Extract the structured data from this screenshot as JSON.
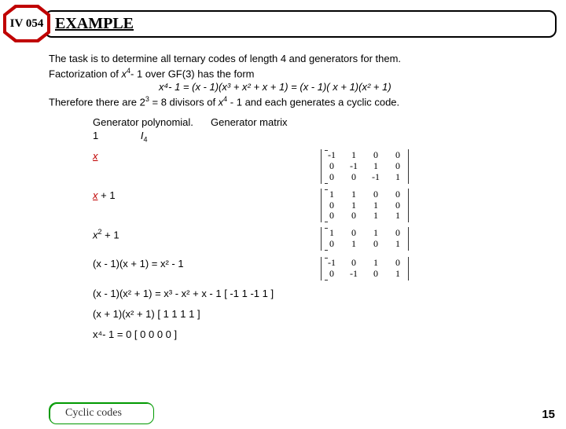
{
  "badge": "IV 054",
  "title": "EXAMPLE",
  "p1": "The task is to determine all ternary codes of length 4 and  generators for them.",
  "p2a": "Factorization of ",
  "p2b": "- 1 over GF(3) has the form",
  "formula": "x⁴- 1 = (x - 1)(x³ + x² + x + 1) = (x - 1)( x + 1)(x² + 1)",
  "p3a": "Therefore there are 2",
  "p3b": " = 8 divisors of ",
  "p3c": " - 1 and each generates a cyclic code.",
  "hdr1": "Generator polynomial.",
  "hdr2": "Generator matrix",
  "rows": {
    "r1a": "1",
    "r1b": "I",
    "r1bsub": "4",
    "r2": "x",
    "r3": "x",
    "r3b": " + 1",
    "r4a": "x",
    "r4b": " + 1",
    "r5": "(x - 1)(x + 1) = x² - 1",
    "r6": "(x - 1)(x² + 1) = x³ - x² + x - 1      [ -1 1 -1 1 ]",
    "r7": "(x + 1)(x² + 1)         [ 1 1 1 1 ]",
    "r8": "x⁴- 1 = 0   [ 0 0 0 0 ]"
  },
  "m1": [
    [
      "-1",
      "1",
      "0",
      "0"
    ],
    [
      "0",
      "-1",
      "1",
      "0"
    ],
    [
      "0",
      "0",
      "-1",
      "1"
    ]
  ],
  "m2": [
    [
      "1",
      "1",
      "0",
      "0"
    ],
    [
      "0",
      "1",
      "1",
      "0"
    ],
    [
      "0",
      "0",
      "1",
      "1"
    ]
  ],
  "m3": [
    [
      "1",
      "0",
      "1",
      "0"
    ],
    [
      "0",
      "1",
      "0",
      "1"
    ]
  ],
  "m4": [
    [
      "-1",
      "0",
      "1",
      "0"
    ],
    [
      "0",
      "-1",
      "0",
      "1"
    ]
  ],
  "footer": "Cyclic codes",
  "page": "15"
}
